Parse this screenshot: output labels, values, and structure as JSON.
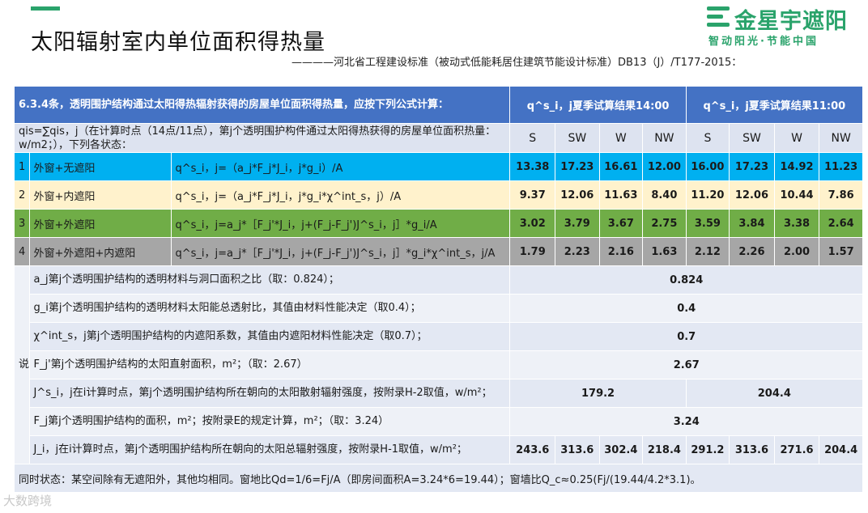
{
  "page": {
    "title": "太阳辐射室内单位面积得热量",
    "subtitle": "————河北省工程建设标准（被动式低能耗居住建筑节能设计标准）DB13（J）/T177-2015：",
    "logo_main": "金星宇遮阳",
    "logo_sub": "智动阳光·节能中国",
    "watermark": "大数跨境"
  },
  "table": {
    "header_left": "6.3.4条，透明围护结构通过太阳得热辐射获得的房屋单位面积得热量，应按下列公式计算：",
    "header_14": "q^s_i，j夏季试算结果14:00",
    "header_11": "q^s_i，j夏季试算结果11:00",
    "sub_left": "qis=∑qis，j（在计算时点（14点/11点），第j个透明围护构件通过太阳得热获得的房屋单位面积热量：w/m2；），下列各状态：",
    "directions": [
      "S",
      "SW",
      "W",
      "NW",
      "S",
      "SW",
      "W",
      "NW"
    ],
    "rows": [
      {
        "idx": "1",
        "name": "外窗+无遮阳",
        "formula": "q^s_i，j=（a_j*F_j*J_i，j*g_i）/A",
        "values": [
          "13.38",
          "17.23",
          "16.61",
          "12.00",
          "16.00",
          "17.23",
          "14.92",
          "11.23"
        ]
      },
      {
        "idx": "2",
        "name": "外窗+内遮阳",
        "formula": "q^s_i，j=（a_j*F_j*J_i，j*g_i*χ^int_s，j）/A",
        "values": [
          "9.37",
          "12.06",
          "11.63",
          "8.40",
          "11.20",
          "12.06",
          "10.44",
          "7.86"
        ]
      },
      {
        "idx": "3",
        "name": "外窗+外遮阳",
        "formula": "q^s_i，j=a_j*［F_j'*J_i，j+(F_j-F_j')J^s_i，j］*g_i/A",
        "values": [
          "3.02",
          "3.79",
          "3.67",
          "2.75",
          "3.59",
          "3.84",
          "3.38",
          "2.64"
        ]
      },
      {
        "idx": "4",
        "name": "外窗+外遮阳+内遮阳",
        "formula": "q^s_i，j=a_j*［F_j'*J_i，j+(F_j-F_j')J^s_i，j］*g_i*χ^int_s，j/A",
        "values": [
          "1.79",
          "2.23",
          "2.16",
          "1.63",
          "2.12",
          "2.26",
          "2.00",
          "1.57"
        ]
      }
    ],
    "notes_label": "说明",
    "notes": [
      {
        "text": "a_j第j个透明围护结构的透明材料与洞口面积之比（取：0.824）；",
        "value": "0.824"
      },
      {
        "text": "g_i第j个透明围护结构的透明材料太阳能总透射比，其值由材料性能决定（取0.4）；",
        "value": "0.4"
      },
      {
        "text": "χ^int_s，j第j个透明围护结构的内遮阳系数，其值由内遮阳材料性能决定（取0.7）；",
        "value": "0.7"
      },
      {
        "text": "F_j'第j个透明围护结构的太阳直射面积，m²；（取：2.67）",
        "value": "2.67"
      },
      {
        "text": "J^s_i，j在i计算时点，第j个透明围护结构所在朝向的太阳散射辐射强度，按附录H-2取值，w/m²；",
        "value_14": "179.2",
        "value_11": "204.4"
      },
      {
        "text": "F_j第j个透明围护结构的面积，m²；按附录E的规定计算，m²；（取：3.24）",
        "value": "3.24"
      },
      {
        "text": "J_i，j在i计算时点，第j个透明围护结构所在朝向的太阳总辐射强度，按附录H-1取值，w/m²；",
        "values": [
          "243.6",
          "313.6",
          "302.4",
          "218.4",
          "291.2",
          "313.6",
          "271.6",
          "204.4"
        ]
      }
    ],
    "footer": "同时状态：某空间除有无遮阳外，其他均相同。窗地比Qd=1/6=Fj/A（即房间面积A=3.24*6=19.44）；窗墙比Q_c≈0.25(Fj/(19.44/4.2*3.1)。"
  }
}
